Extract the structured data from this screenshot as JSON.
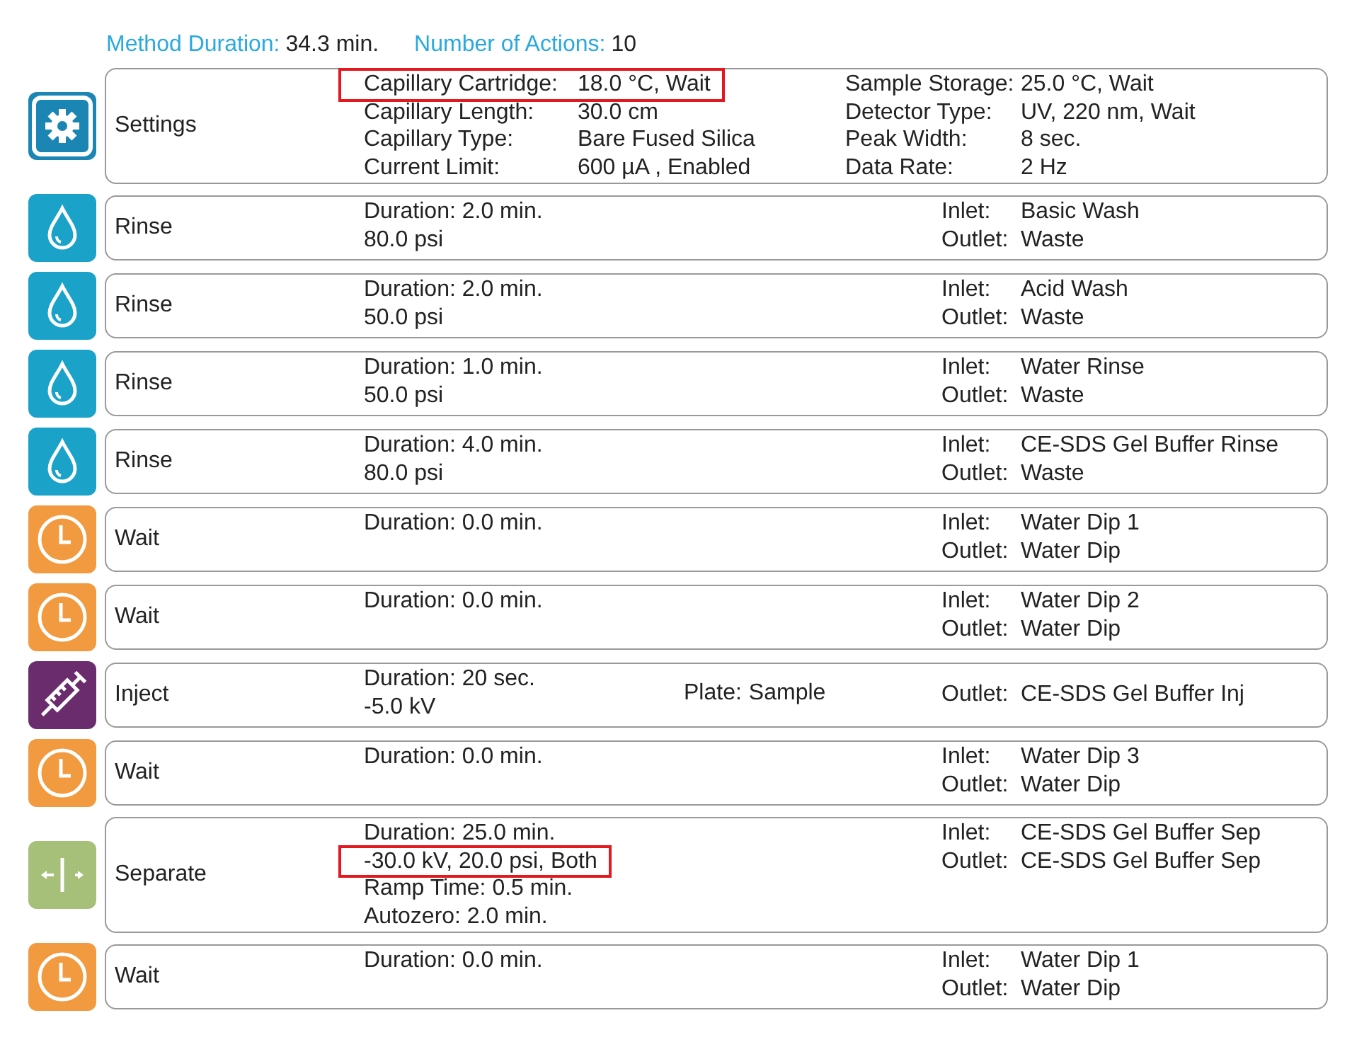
{
  "summary": [
    {
      "label": "Method Duration:",
      "value": "34.3 min."
    },
    {
      "label": "Number of Actions:",
      "value": "10"
    }
  ],
  "steps": [
    {
      "kind": "settings",
      "name": "Settings",
      "groups": [
        [
          {
            "label": "Capillary Cartridge:",
            "value": "18.0 °C, Wait",
            "highlighted": true
          },
          {
            "label": "Capillary Length:",
            "value": "30.0 cm",
            "highlighted": false
          },
          {
            "label": "Capillary Type:",
            "value": "Bare Fused Silica",
            "highlighted": false
          },
          {
            "label": "Current Limit:",
            "value": "600 µA , Enabled",
            "highlighted": false
          }
        ],
        [
          {
            "label": "Sample Storage:",
            "value": "25.0 °C, Wait",
            "highlighted": false
          },
          {
            "label": "Detector Type:",
            "value": "UV, 220 nm, Wait",
            "highlighted": false
          },
          {
            "label": "Peak Width:",
            "value": "8 sec.",
            "highlighted": false
          },
          {
            "label": "Data Rate:",
            "value": "2 Hz",
            "highlighted": false
          }
        ]
      ]
    },
    {
      "kind": "rinse",
      "name": "Rinse",
      "details": [
        {
          "text": "Duration: 2.0 min.",
          "highlighted": false
        },
        {
          "text": "80.0 psi",
          "highlighted": false
        }
      ],
      "ports": [
        {
          "label": "Inlet:",
          "value": "Basic Wash"
        },
        {
          "label": "Outlet:",
          "value": "Waste"
        }
      ]
    },
    {
      "kind": "rinse",
      "name": "Rinse",
      "details": [
        {
          "text": "Duration: 2.0 min.",
          "highlighted": false
        },
        {
          "text": "50.0 psi",
          "highlighted": false
        }
      ],
      "ports": [
        {
          "label": "Inlet:",
          "value": "Acid Wash"
        },
        {
          "label": "Outlet:",
          "value": "Waste"
        }
      ]
    },
    {
      "kind": "rinse",
      "name": "Rinse",
      "details": [
        {
          "text": "Duration: 1.0 min.",
          "highlighted": false
        },
        {
          "text": "50.0 psi",
          "highlighted": false
        }
      ],
      "ports": [
        {
          "label": "Inlet:",
          "value": "Water Rinse"
        },
        {
          "label": "Outlet:",
          "value": "Waste"
        }
      ]
    },
    {
      "kind": "rinse",
      "name": "Rinse",
      "details": [
        {
          "text": "Duration: 4.0 min.",
          "highlighted": false
        },
        {
          "text": "80.0 psi",
          "highlighted": false
        }
      ],
      "ports": [
        {
          "label": "Inlet:",
          "value": "CE-SDS Gel Buffer Rinse"
        },
        {
          "label": "Outlet:",
          "value": "Waste"
        }
      ]
    },
    {
      "kind": "wait",
      "name": "Wait",
      "details": [
        {
          "text": "Duration: 0.0 min.",
          "highlighted": false
        }
      ],
      "ports": [
        {
          "label": "Inlet:",
          "value": "Water Dip 1"
        },
        {
          "label": "Outlet:",
          "value": "Water Dip"
        }
      ]
    },
    {
      "kind": "wait",
      "name": "Wait",
      "details": [
        {
          "text": "Duration: 0.0 min.",
          "highlighted": false
        }
      ],
      "ports": [
        {
          "label": "Inlet:",
          "value": "Water Dip 2"
        },
        {
          "label": "Outlet:",
          "value": "Water Dip"
        }
      ]
    },
    {
      "kind": "inject",
      "name": "Inject",
      "details": [
        {
          "text": "Duration: 20 sec.",
          "highlighted": false
        },
        {
          "text": "-5.0 kV",
          "highlighted": false
        }
      ],
      "plate": {
        "label": "Plate:",
        "value": "Sample"
      },
      "ports": [
        {
          "label": "Outlet:",
          "value": "CE-SDS Gel Buffer Inj"
        }
      ]
    },
    {
      "kind": "wait",
      "name": "Wait",
      "details": [
        {
          "text": "Duration: 0.0 min.",
          "highlighted": false
        }
      ],
      "ports": [
        {
          "label": "Inlet:",
          "value": "Water Dip 3"
        },
        {
          "label": "Outlet:",
          "value": "Water Dip"
        }
      ]
    },
    {
      "kind": "separate",
      "name": "Separate",
      "details": [
        {
          "text": "Duration: 25.0 min.",
          "highlighted": false
        },
        {
          "text": "-30.0 kV, 20.0 psi, Both",
          "highlighted": true
        },
        {
          "text": "Ramp Time: 0.5 min.",
          "highlighted": false
        },
        {
          "text": "Autozero: 2.0 min.",
          "highlighted": false
        }
      ],
      "ports": [
        {
          "label": "Inlet:",
          "value": "CE-SDS Gel Buffer Sep"
        },
        {
          "label": "Outlet:",
          "value": "CE-SDS Gel Buffer Sep"
        }
      ]
    },
    {
      "kind": "wait",
      "name": "Wait",
      "details": [
        {
          "text": "Duration: 0.0 min.",
          "highlighted": false
        }
      ],
      "ports": [
        {
          "label": "Inlet:",
          "value": "Water Dip 1"
        },
        {
          "label": "Outlet:",
          "value": "Water Dip"
        }
      ]
    }
  ]
}
